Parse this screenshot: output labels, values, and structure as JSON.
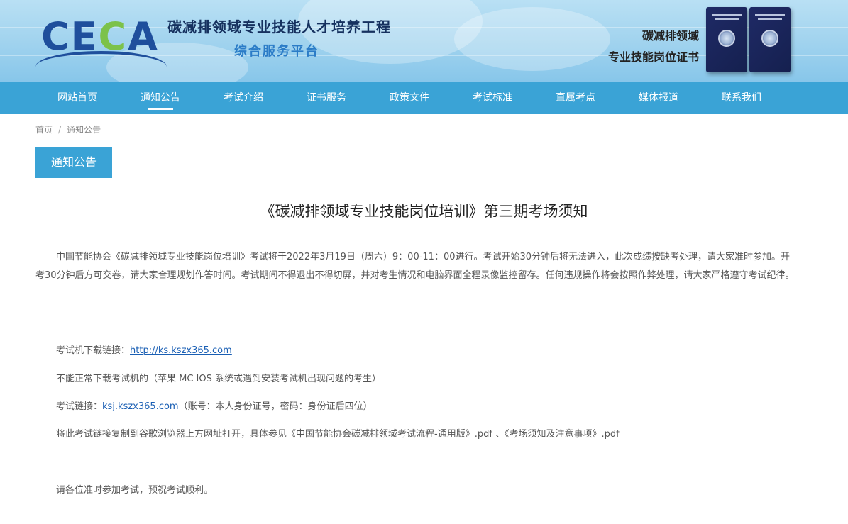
{
  "header": {
    "logo_text": "CECA",
    "site_title": "碳减排领域专业技能人才培养工程",
    "site_subtitle": "综合服务平台",
    "cert_label_line1": "碳减排领域",
    "cert_label_line2": "专业技能岗位证书"
  },
  "nav": {
    "items": [
      {
        "label": "网站首页"
      },
      {
        "label": "通知公告",
        "active": true
      },
      {
        "label": "考试介绍"
      },
      {
        "label": "证书服务"
      },
      {
        "label": "政策文件"
      },
      {
        "label": "考试标准"
      },
      {
        "label": "直属考点"
      },
      {
        "label": "媒体报道"
      },
      {
        "label": "联系我们"
      }
    ]
  },
  "breadcrumb": {
    "home": "首页",
    "separator": "/",
    "current": "通知公告"
  },
  "section_tab": "通知公告",
  "article": {
    "title": "《碳减排领域专业技能岗位培训》第三期考场须知",
    "intro": "中国节能协会《碳减排领域专业技能岗位培训》考试将于2022年3月19日（周六）9：00-11：00进行。考试开始30分钟后将无法进入，此次成绩按缺考处理，请大家准时参加。开考30分钟后方可交卷，请大家合理规划作答时间。考试期间不得退出不得切屏，并对考生情况和电脑界面全程录像监控留存。任何违规操作将会按照作弊处理，请大家严格遵守考试纪律。",
    "download_label": "考试机下载链接：",
    "download_url": "http://ks.kszx365.com",
    "ios_note": "不能正常下载考试机的（苹果 MC IOS 系统或遇到安装考试机出现问题的考生）",
    "exam_link_label": "考试链接：",
    "exam_link_url": "ksj.kszx365.com",
    "exam_link_note": "（账号：本人身份证号，密码：身份证后四位）",
    "copy_note": "将此考试链接复制到谷歌浏览器上方网址打开，具体参见《中国节能协会碳减排领域考试流程-通用版》.pdf 、《考场须知及注意事项》.pdf",
    "closing": "请各位准时参加考试，预祝考试顺利。"
  },
  "colors": {
    "nav_bg": "#3aa3d6",
    "link": "#1a5fb4",
    "logo_blue": "#1f4f9c",
    "logo_green": "#7cc24a"
  }
}
